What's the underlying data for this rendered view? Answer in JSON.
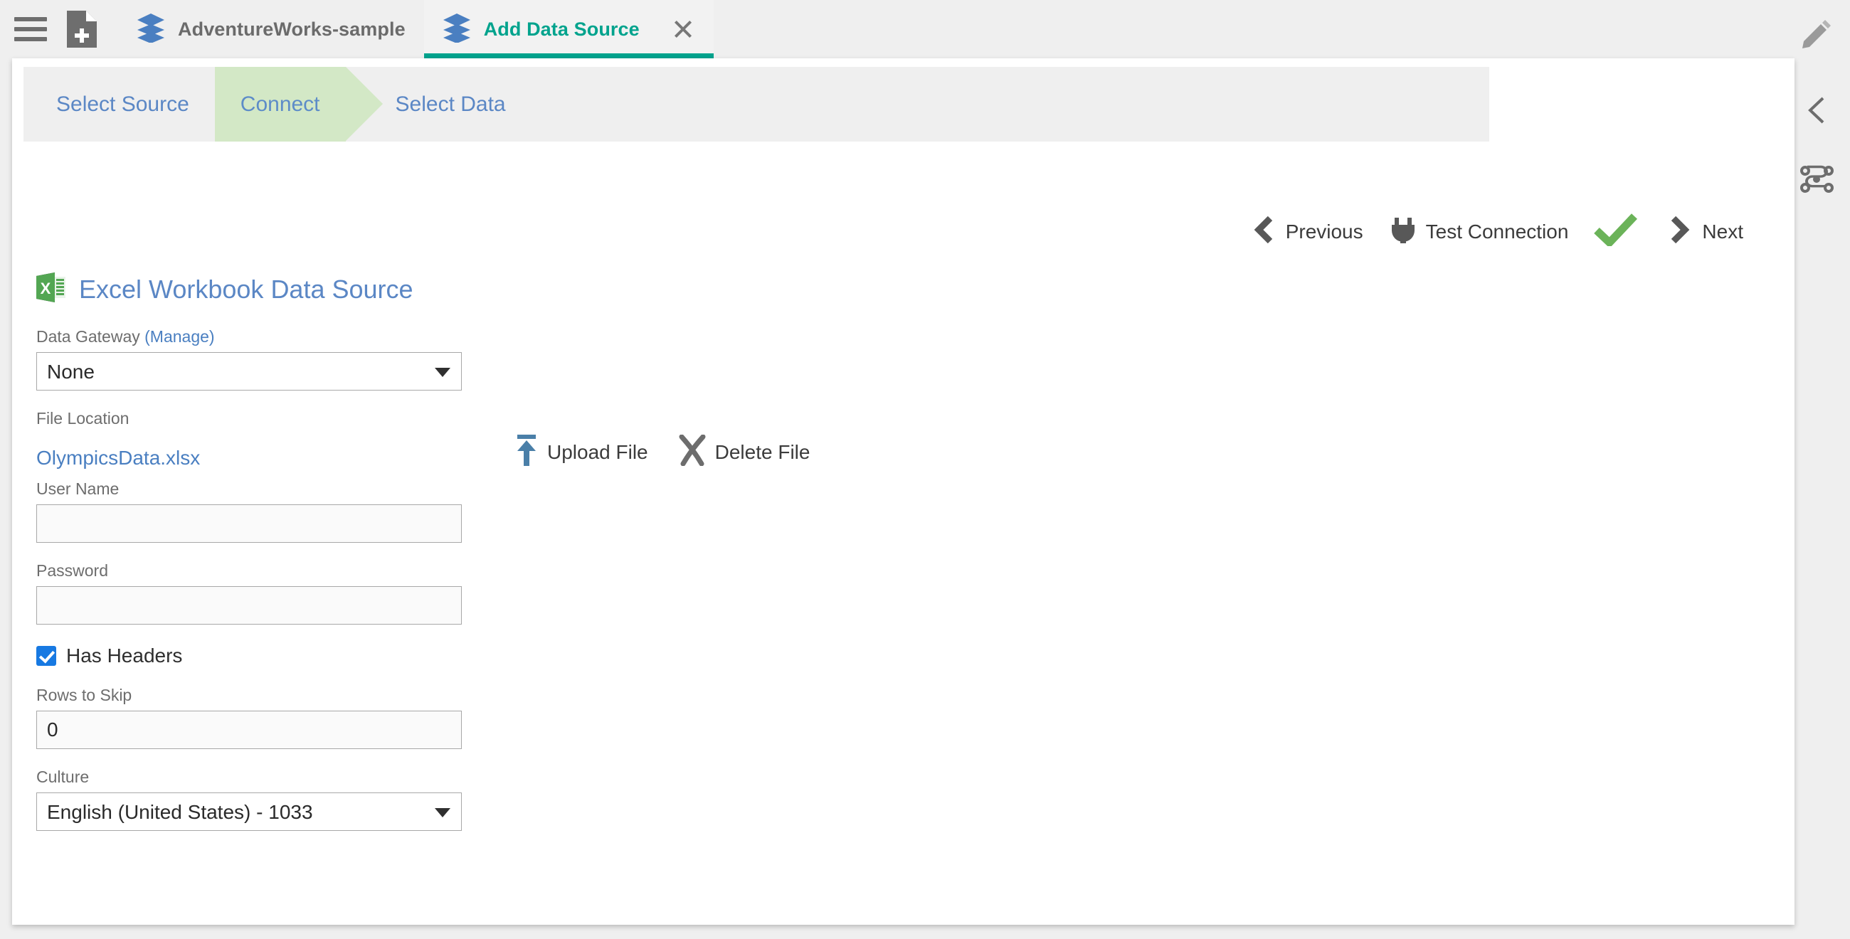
{
  "tabbar": {
    "menu_icon": "hamburger-menu-icon",
    "new_doc_icon": "new-document-icon",
    "tabs": [
      {
        "label": "AdventureWorks-sample",
        "icon": "layers-icon",
        "active": false
      },
      {
        "label": "Add Data Source",
        "icon": "layers-icon",
        "active": true
      }
    ],
    "close_icon": "close-icon"
  },
  "right_rail": {
    "items": [
      {
        "icon": "pencil-edit-icon"
      },
      {
        "icon": "chevron-left-collapse-icon"
      },
      {
        "icon": "relationships-node-icon"
      }
    ]
  },
  "wizard": {
    "steps": [
      {
        "label": "Select Source",
        "state": "done"
      },
      {
        "label": "Connect",
        "state": "current"
      },
      {
        "label": "Select Data",
        "state": "upcoming"
      }
    ],
    "current_color": "#d3e8c6"
  },
  "nav_actions": {
    "previous": {
      "label": "Previous",
      "icon": "chevron-left-icon"
    },
    "test_connection": {
      "label": "Test Connection",
      "icon": "plug-icon"
    },
    "status": {
      "icon": "green-check-icon",
      "color": "#6bb359"
    },
    "next": {
      "label": "Next",
      "icon": "chevron-right-icon"
    }
  },
  "data_source": {
    "title": "Excel Workbook Data Source",
    "icon": "excel-workbook-icon",
    "title_color": "#5b87c5"
  },
  "form": {
    "data_gateway": {
      "label": "Data Gateway ",
      "manage_link": "(Manage)",
      "value": "None",
      "options": [
        "None"
      ]
    },
    "file_location": {
      "label": "File Location",
      "file_name": "OlympicsData.xlsx",
      "upload": {
        "label": "Upload File",
        "icon": "upload-arrow-icon"
      },
      "delete": {
        "label": "Delete File",
        "icon": "x-delete-icon"
      }
    },
    "user_name": {
      "label": "User Name",
      "value": "",
      "placeholder": ""
    },
    "password": {
      "label": "Password",
      "value": "",
      "placeholder": ""
    },
    "has_headers": {
      "label": "Has Headers",
      "checked": true
    },
    "rows_to_skip": {
      "label": "Rows to Skip",
      "value": "0"
    },
    "culture": {
      "label": "Culture",
      "value": "English (United States) - 1033",
      "options": [
        "English (United States) - 1033"
      ]
    }
  }
}
